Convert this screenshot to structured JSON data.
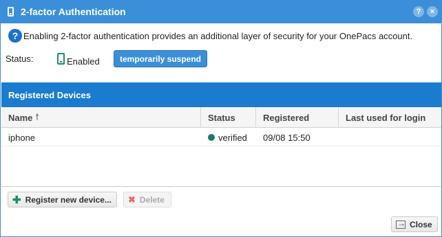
{
  "window": {
    "title": "2-factor Authentication",
    "help_label": "?",
    "close_label": "×"
  },
  "info": {
    "icon": "question-circle",
    "text": "Enabling 2-factor authentication provides an additional layer of security for your OnePacs account."
  },
  "status": {
    "label": "Status:",
    "value": "Enabled",
    "icon": "phone-icon",
    "suspend_button": "temporarily suspend"
  },
  "devices": {
    "header": "Registered Devices",
    "columns": [
      {
        "label": "Name",
        "sorted": "ascending"
      },
      {
        "label": "Status"
      },
      {
        "label": "Registered"
      },
      {
        "label": "Last used for login"
      }
    ],
    "rows": [
      {
        "name": "iphone",
        "status": "verified",
        "status_color": "#1a7a66",
        "registered": "09/08 15:50",
        "last_used": ""
      }
    ]
  },
  "actions": {
    "register": "Register new device...",
    "delete": "Delete",
    "close": "Close"
  },
  "colors": {
    "titlebar": "#3b8fd9",
    "panel_header": "#1b7bcf",
    "verified_dot": "#1a7a66"
  }
}
